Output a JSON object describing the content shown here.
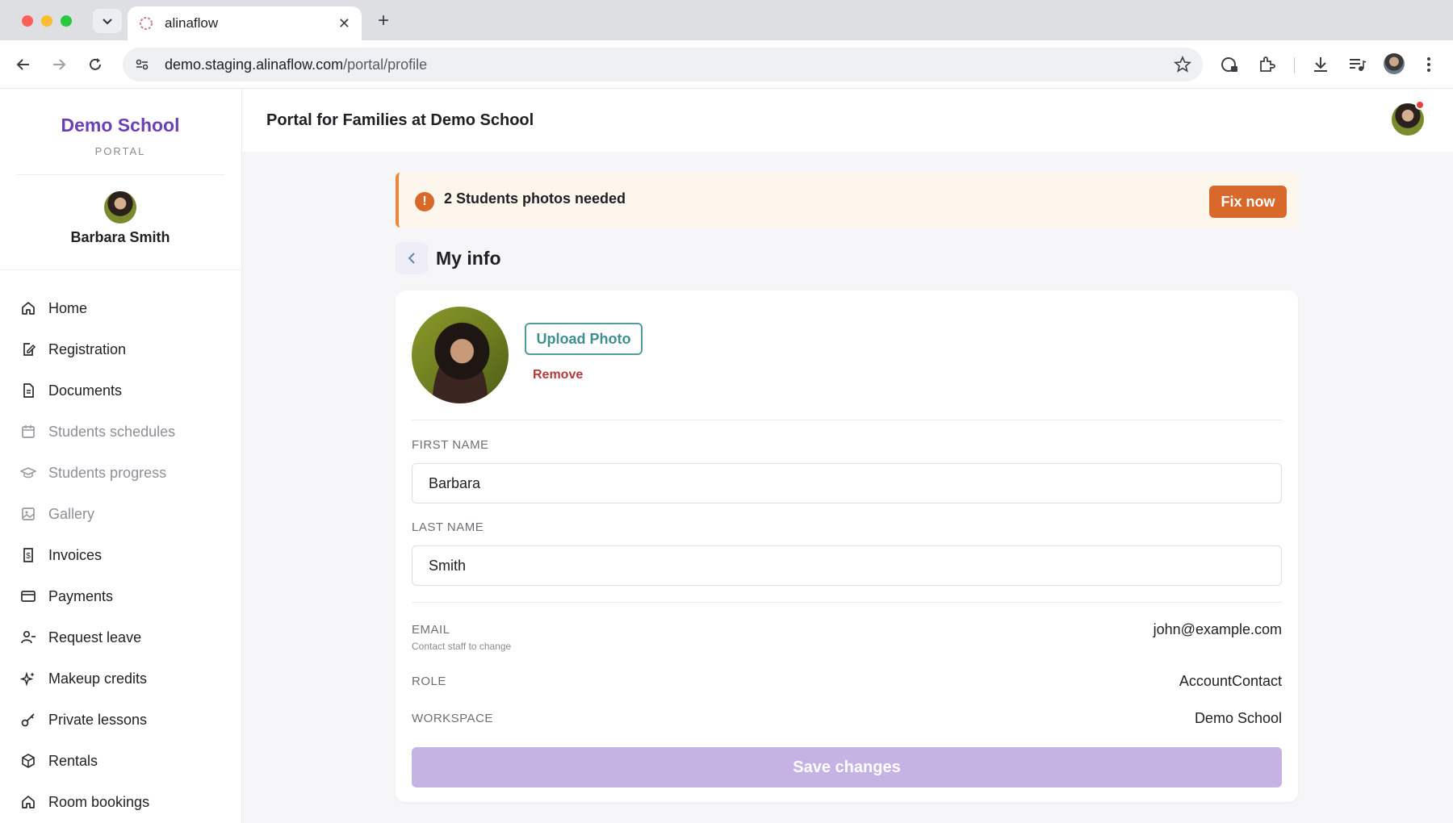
{
  "browser": {
    "tab_title": "alinaflow",
    "url_domain": "demo.staging.alinaflow.com",
    "url_path": "/portal/profile"
  },
  "sidebar": {
    "brand": "Demo School",
    "brand_sub": "PORTAL",
    "user_name": "Barbara Smith",
    "items": [
      {
        "label": "Home",
        "icon": "home-icon",
        "muted": false
      },
      {
        "label": "Registration",
        "icon": "registration-icon",
        "muted": false
      },
      {
        "label": "Documents",
        "icon": "document-icon",
        "muted": false
      },
      {
        "label": "Students schedules",
        "icon": "calendar-icon",
        "muted": true
      },
      {
        "label": "Students progress",
        "icon": "graduation-cap-icon",
        "muted": true
      },
      {
        "label": "Gallery",
        "icon": "image-icon",
        "muted": true
      },
      {
        "label": "Invoices",
        "icon": "invoice-icon",
        "muted": false
      },
      {
        "label": "Payments",
        "icon": "credit-card-icon",
        "muted": false
      },
      {
        "label": "Request leave",
        "icon": "user-minus-icon",
        "muted": false
      },
      {
        "label": "Makeup credits",
        "icon": "sparkles-icon",
        "muted": false
      },
      {
        "label": "Private lessons",
        "icon": "key-icon",
        "muted": false
      },
      {
        "label": "Rentals",
        "icon": "box-icon",
        "muted": false
      },
      {
        "label": "Room bookings",
        "icon": "home-icon",
        "muted": false
      }
    ]
  },
  "header": {
    "title": "Portal for Families at Demo School"
  },
  "alert": {
    "text": "2 Students photos needed",
    "action": "Fix now"
  },
  "section": {
    "title": "My info"
  },
  "profile": {
    "upload_label": "Upload Photo",
    "remove_label": "Remove",
    "first_name_label": "FIRST NAME",
    "first_name_value": "Barbara",
    "last_name_label": "LAST NAME",
    "last_name_value": "Smith",
    "email_label": "EMAIL",
    "email_hint": "Contact staff to change",
    "email_value": "john@example.com",
    "role_label": "ROLE",
    "role_value": "AccountContact",
    "workspace_label": "WORKSPACE",
    "workspace_value": "Demo School",
    "save_label": "Save changes"
  },
  "colors": {
    "brand": "#6b3fb6",
    "alert_accent": "#d9692b",
    "upload_accent": "#4f9c9c",
    "remove": "#b53a3a",
    "save_disabled": "#c5b4e3"
  }
}
